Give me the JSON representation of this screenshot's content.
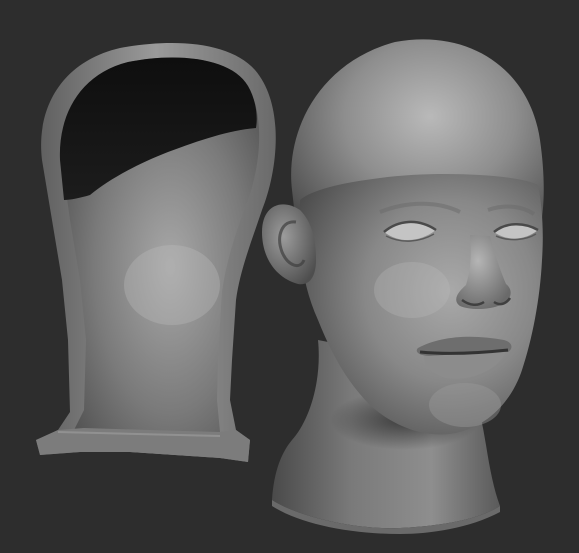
{
  "scene": {
    "background_color": "#2d2d2d",
    "material_color": "#8a8a8a",
    "objects": [
      {
        "name": "hollow-head-shell-cutaway"
      },
      {
        "name": "sculpted-head-bust"
      }
    ]
  }
}
